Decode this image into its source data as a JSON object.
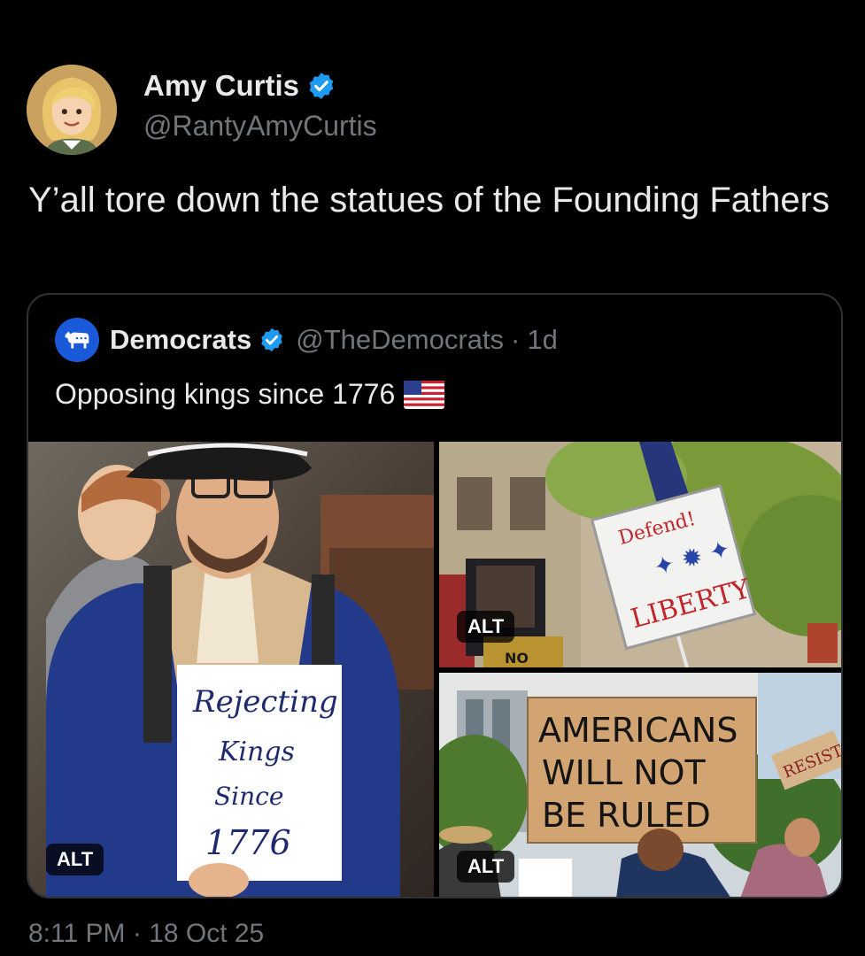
{
  "author": {
    "name": "Amy Curtis",
    "handle": "@RantyAmyCurtis",
    "avatar_icon": "cartoon-avatar-icon",
    "verified_icon": "verified-badge-icon",
    "verified_color": "#1d9bf0"
  },
  "tweet": {
    "text": "Y’all tore down the statues of the Founding Fathers",
    "timestamp": "8:11 PM · 18 Oct 25"
  },
  "quote": {
    "name": "Democrats",
    "handle": "@TheDemocrats",
    "separator": "·",
    "age": "1d",
    "avatar_icon": "donkey-logo-icon",
    "avatar_color": "#1a5ad9",
    "text": "Opposing kings since 1776",
    "emoji_icon": "us-flag-icon",
    "media": [
      {
        "alt_badge": "ALT",
        "sign_lines": [
          "Rejecting",
          "Kings",
          "Since",
          "1776"
        ]
      },
      {
        "alt_badge": "ALT",
        "sign_lines": [
          "Defend!",
          "LIBERTY"
        ]
      },
      {
        "alt_badge": "ALT",
        "sign_lines": [
          "AMERICANS",
          "WILL NOT",
          "BE RULED"
        ],
        "side_sign": "RESIST"
      }
    ]
  }
}
